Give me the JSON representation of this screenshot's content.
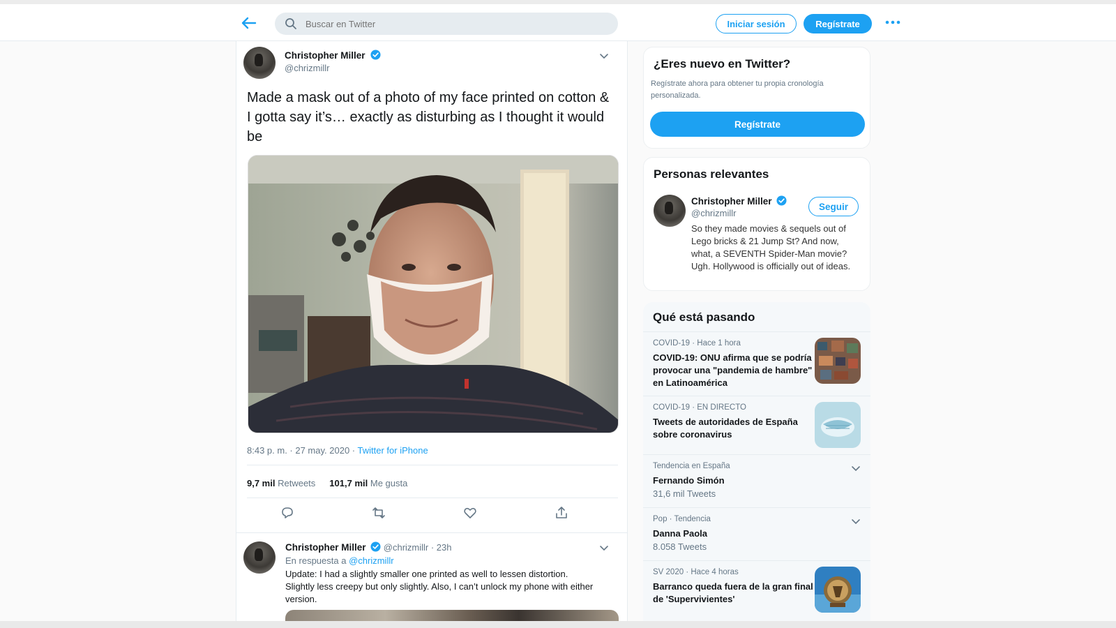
{
  "header": {
    "search_placeholder": "Buscar en Twitter",
    "login_label": "Iniciar sesión",
    "signup_label": "Regístrate"
  },
  "tweet": {
    "author_name": "Christopher Miller",
    "author_handle": "@chrizmillr",
    "text": "Made a mask out of a photo of my face printed on cotton & I gotta say it’s… exactly as disturbing as I thought it would be",
    "timestamp": "8:43 p. m. · 27 may. 2020 ·",
    "source": "Twitter for iPhone",
    "retweets_count": "9,7 mil",
    "retweets_label": "Retweets",
    "likes_count": "101,7 mil",
    "likes_label": "Me gusta"
  },
  "reply": {
    "author_name": "Christopher Miller",
    "author_handle": "@chrizmillr",
    "time": "· 23h",
    "reply_to_label": "En respuesta a",
    "reply_to_handle": "@chrizmillr",
    "text": "Update: I had a slightly smaller one printed as well to lessen distortion. Slightly less creepy but only slightly. Also, I can’t unlock my phone with either version."
  },
  "new_to_twitter": {
    "title": "¿Eres nuevo en Twitter?",
    "description": "Regístrate ahora para obtener tu propia cronología personalizada.",
    "button_label": "Regístrate"
  },
  "relevant_people": {
    "title": "Personas relevantes",
    "name": "Christopher Miller",
    "handle": "@chrizmillr",
    "follow_label": "Seguir",
    "bio": "So they made movies & sequels out of Lego bricks & 21 Jump St? And now, what, a SEVENTH Spider-Man movie? Ugh. Hollywood is officially out of ideas."
  },
  "trends": {
    "title": "Qué está pasando",
    "items": [
      {
        "category": "COVID-19 · Hace 1 hora",
        "title": "COVID-19: ONU afirma que se podría provocar una \"pandemia de hambre\" en Latinoamérica",
        "count": ""
      },
      {
        "category": "COVID-19 · EN DIRECTO",
        "title": "Tweets de autoridades de España sobre coronavirus",
        "count": ""
      },
      {
        "category": "Tendencia en España",
        "title": "Fernando Simón",
        "count": "31,6 mil Tweets"
      },
      {
        "category": "Pop · Tendencia",
        "title": "Danna Paola",
        "count": "8.058 Tweets"
      },
      {
        "category": "SV 2020 · Hace 4 horas",
        "title": "Barranco queda fuera de la gran final de 'Supervivientes'",
        "count": ""
      }
    ]
  },
  "colors": {
    "accent": "#1da1f2",
    "secondary_text": "#657786",
    "primary_text": "#14171a"
  },
  "icons": [
    "back-arrow-icon",
    "search-icon",
    "more-dots-icon",
    "verified-icon",
    "chevron-down-icon",
    "reply-icon",
    "retweet-icon",
    "like-icon",
    "share-icon"
  ]
}
